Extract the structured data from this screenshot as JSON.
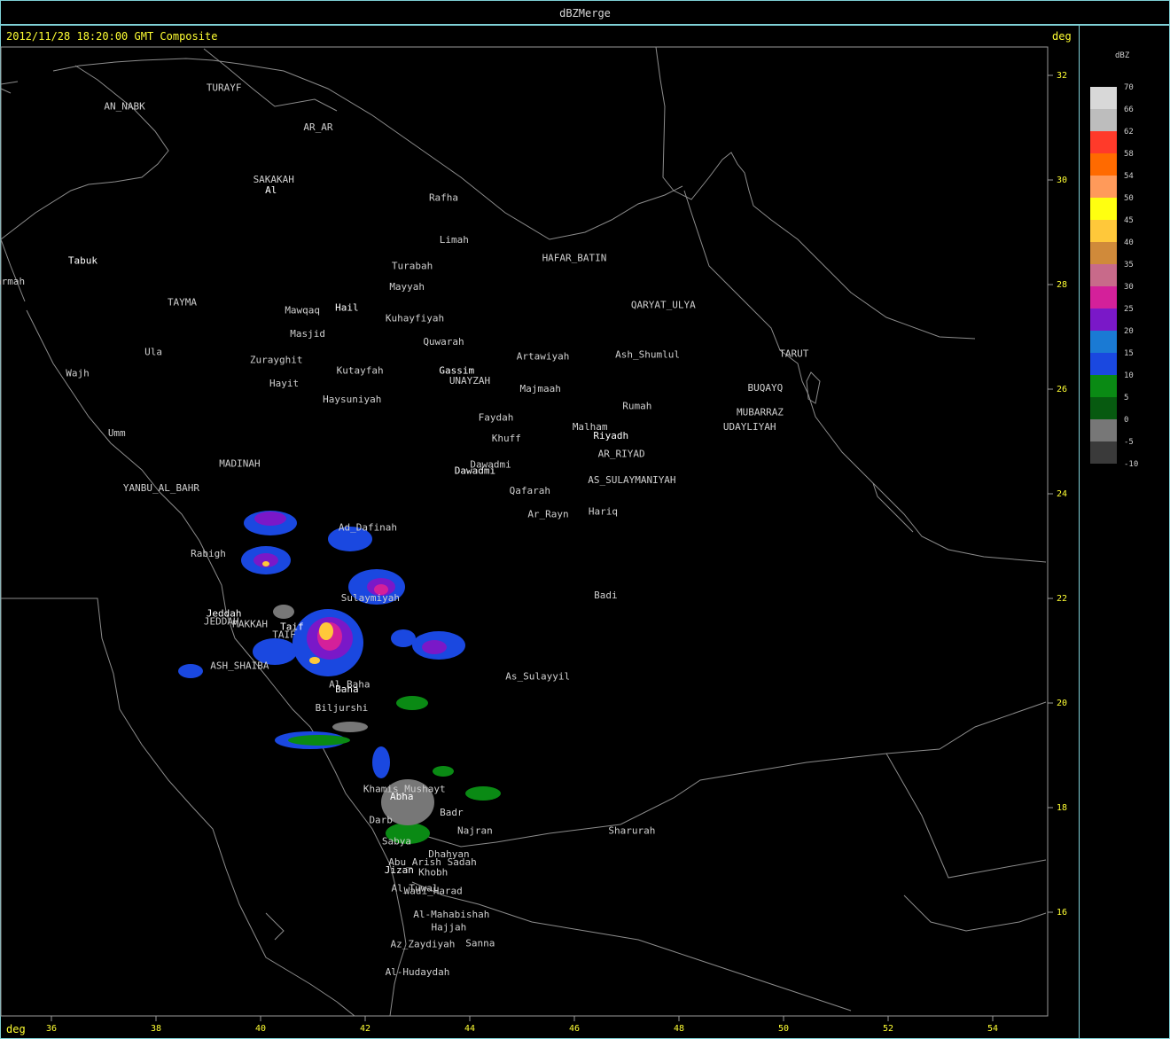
{
  "window": {
    "title": "dBZMerge"
  },
  "header": {
    "timestamp": "2012/11/28 18:20:00 GMT Composite",
    "unit_top": "deg",
    "unit_bottom": "deg"
  },
  "axes": {
    "x_ticks": [
      "36",
      "38",
      "40",
      "42",
      "44",
      "46",
      "48",
      "50",
      "52",
      "54"
    ],
    "y_ticks": [
      "32",
      "30",
      "28",
      "26",
      "24",
      "22",
      "20",
      "18",
      "16"
    ]
  },
  "legend": {
    "title": "dBZ",
    "items": [
      {
        "label": "70",
        "color": "#d8d8d8"
      },
      {
        "label": "66",
        "color": "#bdbdbd"
      },
      {
        "label": "62",
        "color": "#ff3a2a"
      },
      {
        "label": "58",
        "color": "#ff6a00"
      },
      {
        "label": "54",
        "color": "#ff9a5a"
      },
      {
        "label": "50",
        "color": "#ffff10"
      },
      {
        "label": "45",
        "color": "#ffc83a"
      },
      {
        "label": "40",
        "color": "#d08a3a"
      },
      {
        "label": "35",
        "color": "#c86a8a"
      },
      {
        "label": "30",
        "color": "#d4209a"
      },
      {
        "label": "25",
        "color": "#7a18c8"
      },
      {
        "label": "20",
        "color": "#1a7ad4"
      },
      {
        "label": "15",
        "color": "#1a48e0"
      },
      {
        "label": "10",
        "color": "#0a8a14"
      },
      {
        "label": "5",
        "color": "#075a10"
      },
      {
        "label": "0",
        "color": "#777777"
      },
      {
        "label": "-5",
        "color": "#3a3a3a"
      },
      {
        "label": "-10",
        "color": ""
      }
    ]
  },
  "places": [
    {
      "name": "TURAYF",
      "lon": 39.3,
      "lat": 31.7
    },
    {
      "name": "AN_NABK",
      "lon": 37.4,
      "lat": 31.35
    },
    {
      "name": "AR_AR",
      "lon": 41.1,
      "lat": 30.95
    },
    {
      "name": "SAKAKAH",
      "lon": 40.25,
      "lat": 29.95
    },
    {
      "name": "Al",
      "lon": 40.2,
      "lat": 29.75,
      "bright": true
    },
    {
      "name": "Rafha",
      "lon": 43.5,
      "lat": 29.6
    },
    {
      "name": "Limah",
      "lon": 43.7,
      "lat": 28.8
    },
    {
      "name": "Tabuk",
      "lon": 36.6,
      "lat": 28.4,
      "bright": true
    },
    {
      "name": "HAFAR_BATIN",
      "lon": 46.0,
      "lat": 28.45
    },
    {
      "name": "Turabah",
      "lon": 42.9,
      "lat": 28.3
    },
    {
      "name": "Sharmah",
      "lon": 35.1,
      "lat": 28.0
    },
    {
      "name": "Mayyah",
      "lon": 42.8,
      "lat": 27.9
    },
    {
      "name": "TAYMA",
      "lon": 38.5,
      "lat": 27.6
    },
    {
      "name": "QARYAT_ULYA",
      "lon": 47.7,
      "lat": 27.55
    },
    {
      "name": "Mawqaq",
      "lon": 40.8,
      "lat": 27.45
    },
    {
      "name": "Hail",
      "lon": 41.65,
      "lat": 27.5,
      "bright": true
    },
    {
      "name": "Kuhayfiyah",
      "lon": 42.95,
      "lat": 27.3
    },
    {
      "name": "Masjid",
      "lon": 40.9,
      "lat": 27.0
    },
    {
      "name": "Quwarah",
      "lon": 43.5,
      "lat": 26.85
    },
    {
      "name": "Ula",
      "lon": 37.95,
      "lat": 26.65
    },
    {
      "name": "TARUT",
      "lon": 50.2,
      "lat": 26.62
    },
    {
      "name": "Artawiyah",
      "lon": 45.4,
      "lat": 26.57
    },
    {
      "name": "Ash_Shumlul",
      "lon": 47.4,
      "lat": 26.6
    },
    {
      "name": "Zurayghit",
      "lon": 40.3,
      "lat": 26.5
    },
    {
      "name": "Kutayfah",
      "lon": 41.9,
      "lat": 26.3
    },
    {
      "name": "Gassim",
      "lon": 43.75,
      "lat": 26.3,
      "bright": true
    },
    {
      "name": "UNAYZAH",
      "lon": 44.0,
      "lat": 26.1
    },
    {
      "name": "Wajh",
      "lon": 36.5,
      "lat": 26.25
    },
    {
      "name": "Hayit",
      "lon": 40.45,
      "lat": 26.05
    },
    {
      "name": "Majmaah",
      "lon": 45.35,
      "lat": 25.95
    },
    {
      "name": "BUQAYQ",
      "lon": 49.65,
      "lat": 25.97
    },
    {
      "name": "Haysuniyah",
      "lon": 41.75,
      "lat": 25.75
    },
    {
      "name": "Rumah",
      "lon": 47.2,
      "lat": 25.62
    },
    {
      "name": "MUBARRAZ",
      "lon": 49.55,
      "lat": 25.5
    },
    {
      "name": "Faydah",
      "lon": 44.5,
      "lat": 25.4
    },
    {
      "name": "Malham",
      "lon": 46.3,
      "lat": 25.22
    },
    {
      "name": "UDAYLIYAH",
      "lon": 49.35,
      "lat": 25.22
    },
    {
      "name": "Umm",
      "lon": 37.25,
      "lat": 25.1
    },
    {
      "name": "Riyadh",
      "lon": 46.7,
      "lat": 25.05,
      "bright": true
    },
    {
      "name": "Khuff",
      "lon": 44.7,
      "lat": 25.0
    },
    {
      "name": "AR_RIYAD",
      "lon": 46.9,
      "lat": 24.7
    },
    {
      "name": "MADINAH",
      "lon": 39.6,
      "lat": 24.52
    },
    {
      "name": "Dawadmi",
      "lon": 44.4,
      "lat": 24.5
    },
    {
      "name": "Dawadmi",
      "lon": 44.1,
      "lat": 24.38,
      "bright": true
    },
    {
      "name": "AS_SULAYMANIYAH",
      "lon": 47.1,
      "lat": 24.2
    },
    {
      "name": "YANBU_AL_BAHR",
      "lon": 38.1,
      "lat": 24.05
    },
    {
      "name": "Qafarah",
      "lon": 45.15,
      "lat": 24.0
    },
    {
      "name": "Hariq",
      "lon": 46.55,
      "lat": 23.6
    },
    {
      "name": "Ar_Rayn",
      "lon": 45.5,
      "lat": 23.55
    },
    {
      "name": "Ad_Dafinah",
      "lon": 42.05,
      "lat": 23.3
    },
    {
      "name": "Rabigh",
      "lon": 39.0,
      "lat": 22.8
    },
    {
      "name": "Badi",
      "lon": 46.6,
      "lat": 22.0
    },
    {
      "name": "Sulaymiyah",
      "lon": 42.1,
      "lat": 21.95
    },
    {
      "name": "Jeddah",
      "lon": 39.3,
      "lat": 21.65,
      "bright": true
    },
    {
      "name": "JEDDAH",
      "lon": 39.25,
      "lat": 21.5
    },
    {
      "name": "MAKKAH",
      "lon": 39.8,
      "lat": 21.45
    },
    {
      "name": "Taif",
      "lon": 40.6,
      "lat": 21.4,
      "bright": true
    },
    {
      "name": "TAIF",
      "lon": 40.45,
      "lat": 21.25
    },
    {
      "name": "ASH_SHAIBA",
      "lon": 39.6,
      "lat": 20.65
    },
    {
      "name": "As_Sulayyil",
      "lon": 45.3,
      "lat": 20.45
    },
    {
      "name": "Al_Baha",
      "lon": 41.7,
      "lat": 20.3
    },
    {
      "name": "Baha",
      "lon": 41.65,
      "lat": 20.2,
      "bright": true
    },
    {
      "name": "Biljurshi",
      "lon": 41.55,
      "lat": 19.85
    },
    {
      "name": "Khamis_Mushayt",
      "lon": 42.75,
      "lat": 18.3
    },
    {
      "name": "Abha",
      "lon": 42.7,
      "lat": 18.15,
      "bright": true
    },
    {
      "name": "Badr",
      "lon": 43.65,
      "lat": 17.85
    },
    {
      "name": "Darb",
      "lon": 42.3,
      "lat": 17.7
    },
    {
      "name": "Najran",
      "lon": 44.1,
      "lat": 17.5
    },
    {
      "name": "Sharurah",
      "lon": 47.1,
      "lat": 17.5
    },
    {
      "name": "Sabya",
      "lon": 42.6,
      "lat": 17.3
    },
    {
      "name": "Dhahyan",
      "lon": 43.6,
      "lat": 17.05
    },
    {
      "name": "Abu_Arish",
      "lon": 42.95,
      "lat": 16.9
    },
    {
      "name": "Sadah",
      "lon": 43.85,
      "lat": 16.9
    },
    {
      "name": "Jizan",
      "lon": 42.65,
      "lat": 16.75,
      "bright": true
    },
    {
      "name": "Khobh",
      "lon": 43.3,
      "lat": 16.7
    },
    {
      "name": "Al_Tuwal",
      "lon": 42.95,
      "lat": 16.4
    },
    {
      "name": "Wadi_Harad",
      "lon": 43.3,
      "lat": 16.35
    },
    {
      "name": "Al-Mahabishah",
      "lon": 43.65,
      "lat": 15.9
    },
    {
      "name": "Hajjah",
      "lon": 43.6,
      "lat": 15.65
    },
    {
      "name": "Sanna",
      "lon": 44.2,
      "lat": 15.35
    },
    {
      "name": "Az_Zaydiyah",
      "lon": 43.1,
      "lat": 15.33
    },
    {
      "name": "Al-Hudaydah",
      "lon": 43.0,
      "lat": 14.8
    }
  ]
}
